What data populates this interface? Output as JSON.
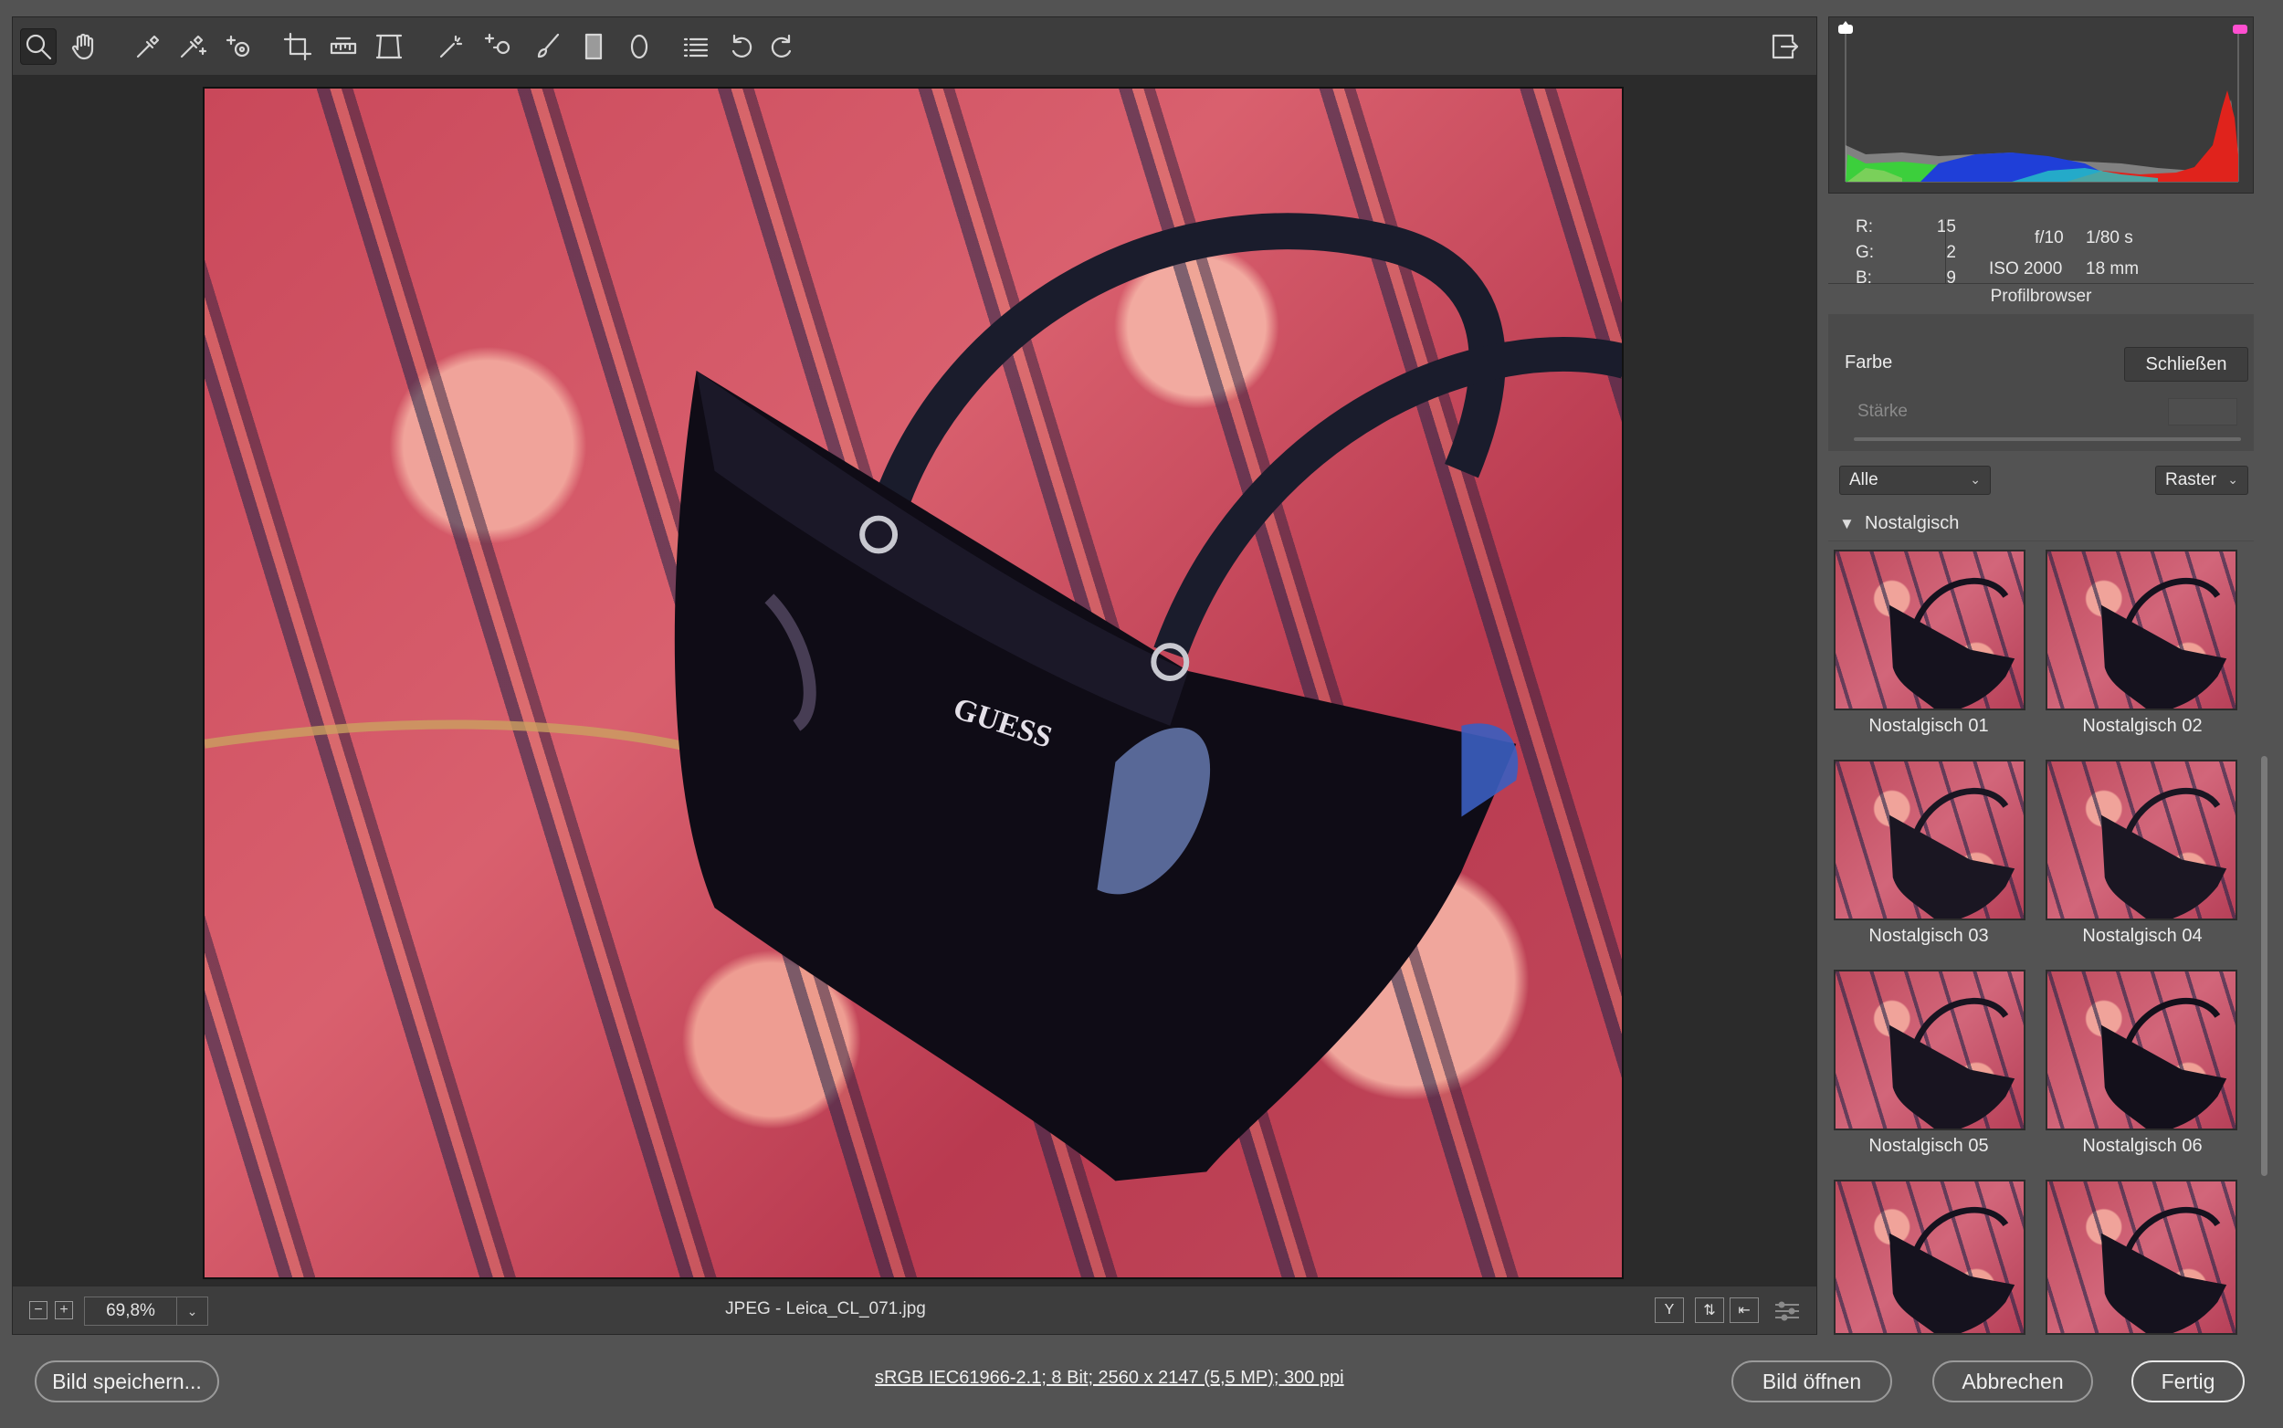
{
  "toolbar": {
    "tools": [
      "zoom-icon",
      "hand-icon",
      "white-balance-icon",
      "color-sampler-icon",
      "targeted-adjust-icon",
      "crop-icon",
      "straighten-icon",
      "transform-icon",
      "spot-removal-icon",
      "red-eye-icon",
      "adjustment-brush-icon",
      "graduated-filter-icon",
      "radial-filter-icon",
      "list-icon",
      "rotate-left-icon",
      "rotate-right-icon"
    ]
  },
  "status": {
    "zoom": "69,8%",
    "filename": "JPEG - Leica_CL_071.jpg"
  },
  "info": {
    "r_label": "R:",
    "r_value": "15",
    "g_label": "G:",
    "g_value": "2",
    "b_label": "B:",
    "b_value": "9",
    "aperture": "f/10",
    "shutter": "1/80 s",
    "iso": "ISO 2000",
    "focal": "18 mm"
  },
  "profile": {
    "title": "Profilbrowser",
    "group_label": "Farbe",
    "close_label": "Schließen",
    "strength_label": "Stärke",
    "filter_value": "Alle",
    "view_value": "Raster",
    "category": "Nostalgisch",
    "items": [
      "Nostalgisch 01",
      "Nostalgisch 02",
      "Nostalgisch 03",
      "Nostalgisch 04",
      "Nostalgisch 05",
      "Nostalgisch 06"
    ]
  },
  "bottom": {
    "save_label": "Bild speichern...",
    "color_info": "sRGB IEC61966-2.1; 8 Bit; 2560 x 2147 (5,5 MP); 300 ppi",
    "open_label": "Bild öffnen",
    "cancel_label": "Abbrechen",
    "done_label": "Fertig"
  },
  "colors": {
    "panel_bg": "#535353",
    "workspace_bg": "#2b2b2b"
  }
}
